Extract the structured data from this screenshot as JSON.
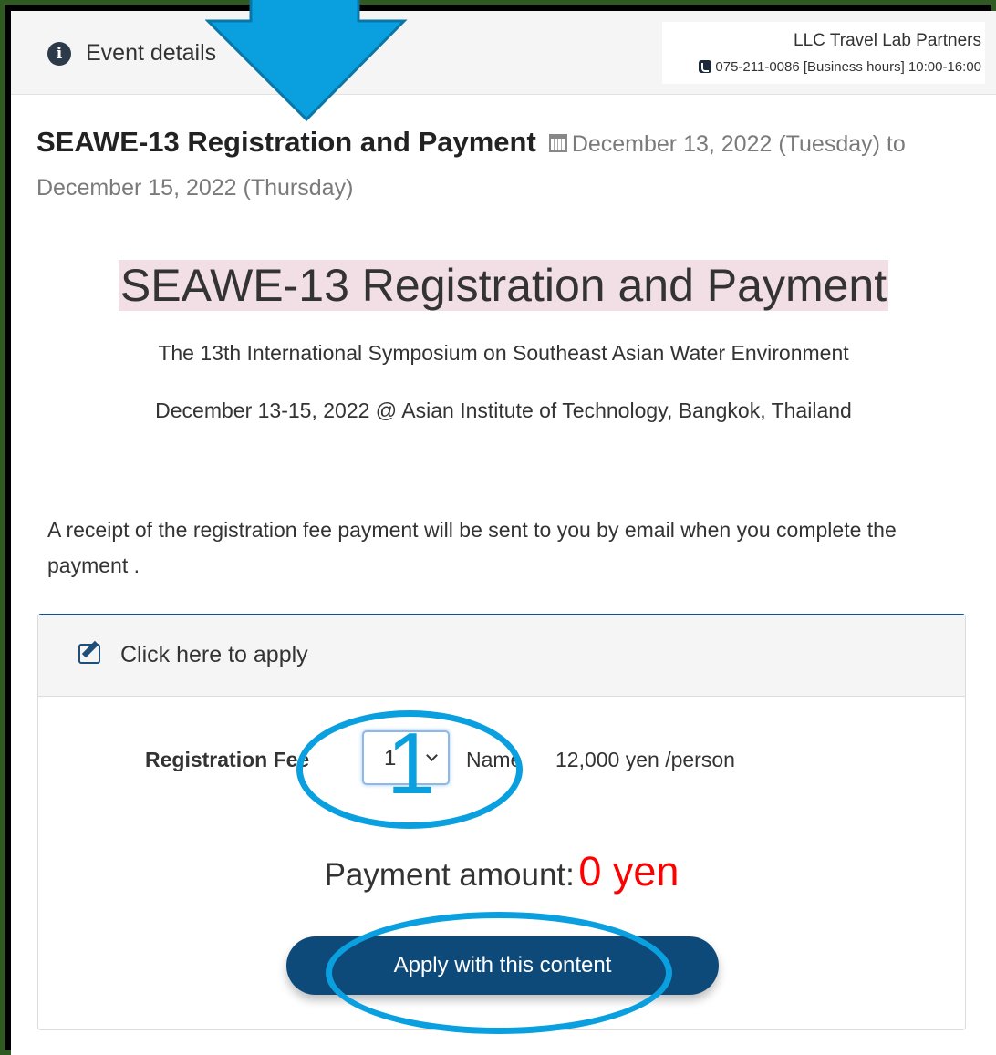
{
  "header": {
    "event_details": "Event details",
    "company_name": "LLC Travel Lab Partners",
    "phone": "075-211-0086 [Business hours] 10:00-16:00"
  },
  "event": {
    "title": "SEAWE-13 Registration and Payment",
    "date_range": "December 13, 2022 (Tuesday) to December 15, 2022 (Thursday)"
  },
  "body": {
    "heading": "SEAWE-13 Registration and Payment",
    "subtitle": "The 13th International Symposium on Southeast Asian Water Environment",
    "venue": "December 13-15, 2022 @ Asian Institute of Technology, Bangkok, Thailand",
    "receipt_note": "A receipt of the registration fee payment will be sent to you by email when you complete the payment ."
  },
  "form": {
    "header_label": "Click here to apply",
    "fee_label": "Registration Fee",
    "quantity": "1",
    "name_label": "Name",
    "price": "12,000 yen /person",
    "payment_label": "Payment amount:",
    "payment_amount": "0 yen",
    "apply_button": "Apply with this content"
  },
  "annotations": {
    "step_number": "1",
    "accent_color": "#0aa0e0"
  }
}
